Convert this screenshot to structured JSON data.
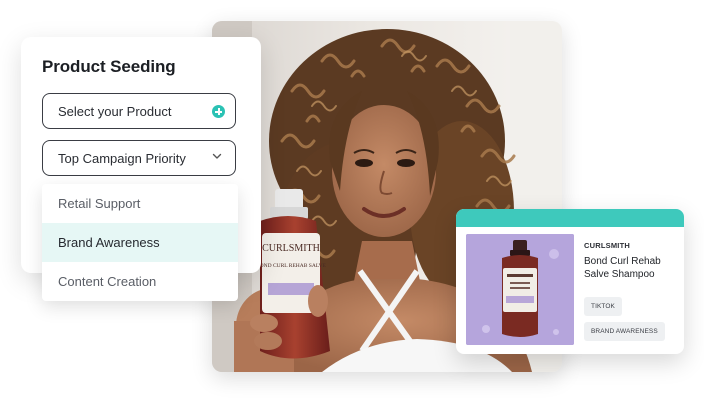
{
  "seeding_card": {
    "title": "Product Seeding",
    "product_select": {
      "label": "Select your Product",
      "icon": "plus-circle-icon"
    },
    "priority_select": {
      "label": "Top Campaign Priority",
      "icon": "chevron-down-icon"
    }
  },
  "dropdown": {
    "options": [
      {
        "label": "Retail Support",
        "selected": false
      },
      {
        "label": "Brand Awareness",
        "selected": true
      },
      {
        "label": "Content Creation",
        "selected": false
      }
    ]
  },
  "product_card": {
    "brand": "CURLSMITH",
    "name": "Bond Curl Rehab Salve Shampoo",
    "tags": [
      "TIKTOK",
      "BRAND AWARENESS"
    ]
  },
  "photo": {
    "bottle_brand": "CURLSMITH",
    "bottle_name": "BOND CURL REHAB SALVE"
  },
  "colors": {
    "accent": "#3ec9bc",
    "plus_icon": "#2bc2b4",
    "selected_row": "#e6f7f5",
    "thumb_bg": "#b5a5dc"
  }
}
